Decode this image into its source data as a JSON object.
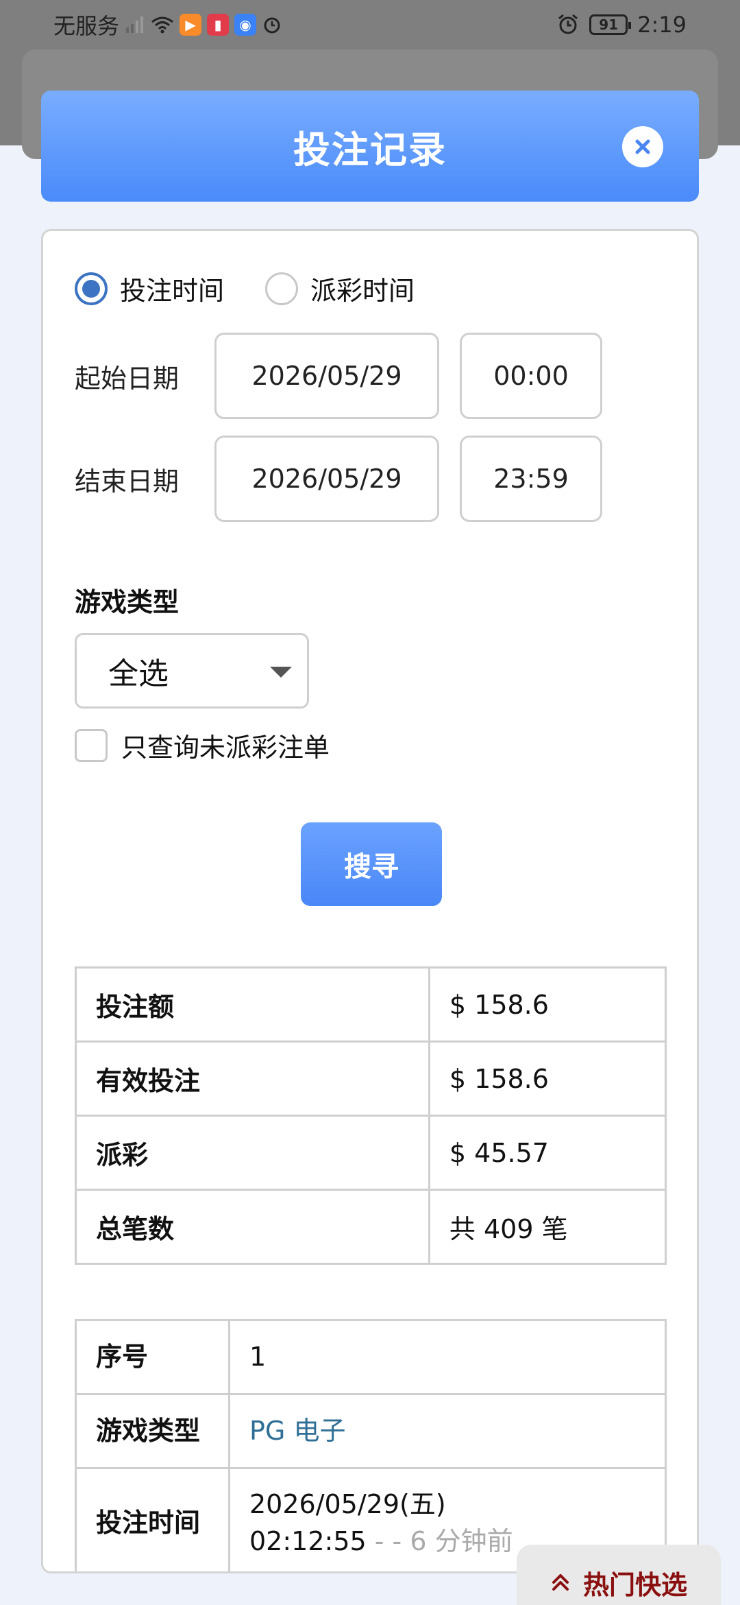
{
  "status_bar": {
    "carrier": "无服务",
    "time": "2:19",
    "battery": "91"
  },
  "modal": {
    "title": "投注记录",
    "close_icon": "close-icon"
  },
  "filter": {
    "radio_bet_time": "投注时间",
    "radio_payout_time": "派彩时间",
    "start_label": "起始日期",
    "start_date": "2026/05/29",
    "start_time": "00:00",
    "end_label": "结束日期",
    "end_date": "2026/05/29",
    "end_time": "23:59",
    "game_type_label": "游戏类型",
    "game_type_value": "全选",
    "unsettled_only": "只查询未派彩注单",
    "search_button": "搜寻"
  },
  "summary": [
    {
      "key": "投注额",
      "value": "$ 158.6"
    },
    {
      "key": "有效投注",
      "value": "$ 158.6"
    },
    {
      "key": "派彩",
      "value": "$ 45.57"
    },
    {
      "key": "总笔数",
      "value": "共 409 笔"
    }
  ],
  "detail": {
    "index_label": "序号",
    "index_value": "1",
    "game_type_label": "游戏类型",
    "game_type_value": "PG 电子",
    "bet_time_label": "投注时间",
    "bet_date": "2026/05/29(五)",
    "bet_clock": "02:12:55",
    "bet_relative": " - - 6 分钟前"
  },
  "hot_pick": {
    "label": "热门快选",
    "icon": "double-chevron-up-icon"
  },
  "colors": {
    "header_gradient_top": "#79adff",
    "header_gradient_bottom": "#4a8bfa",
    "radio_checked": "#3c73c2",
    "link": "#2f6f96",
    "hot_pick_text": "#8a1010"
  }
}
